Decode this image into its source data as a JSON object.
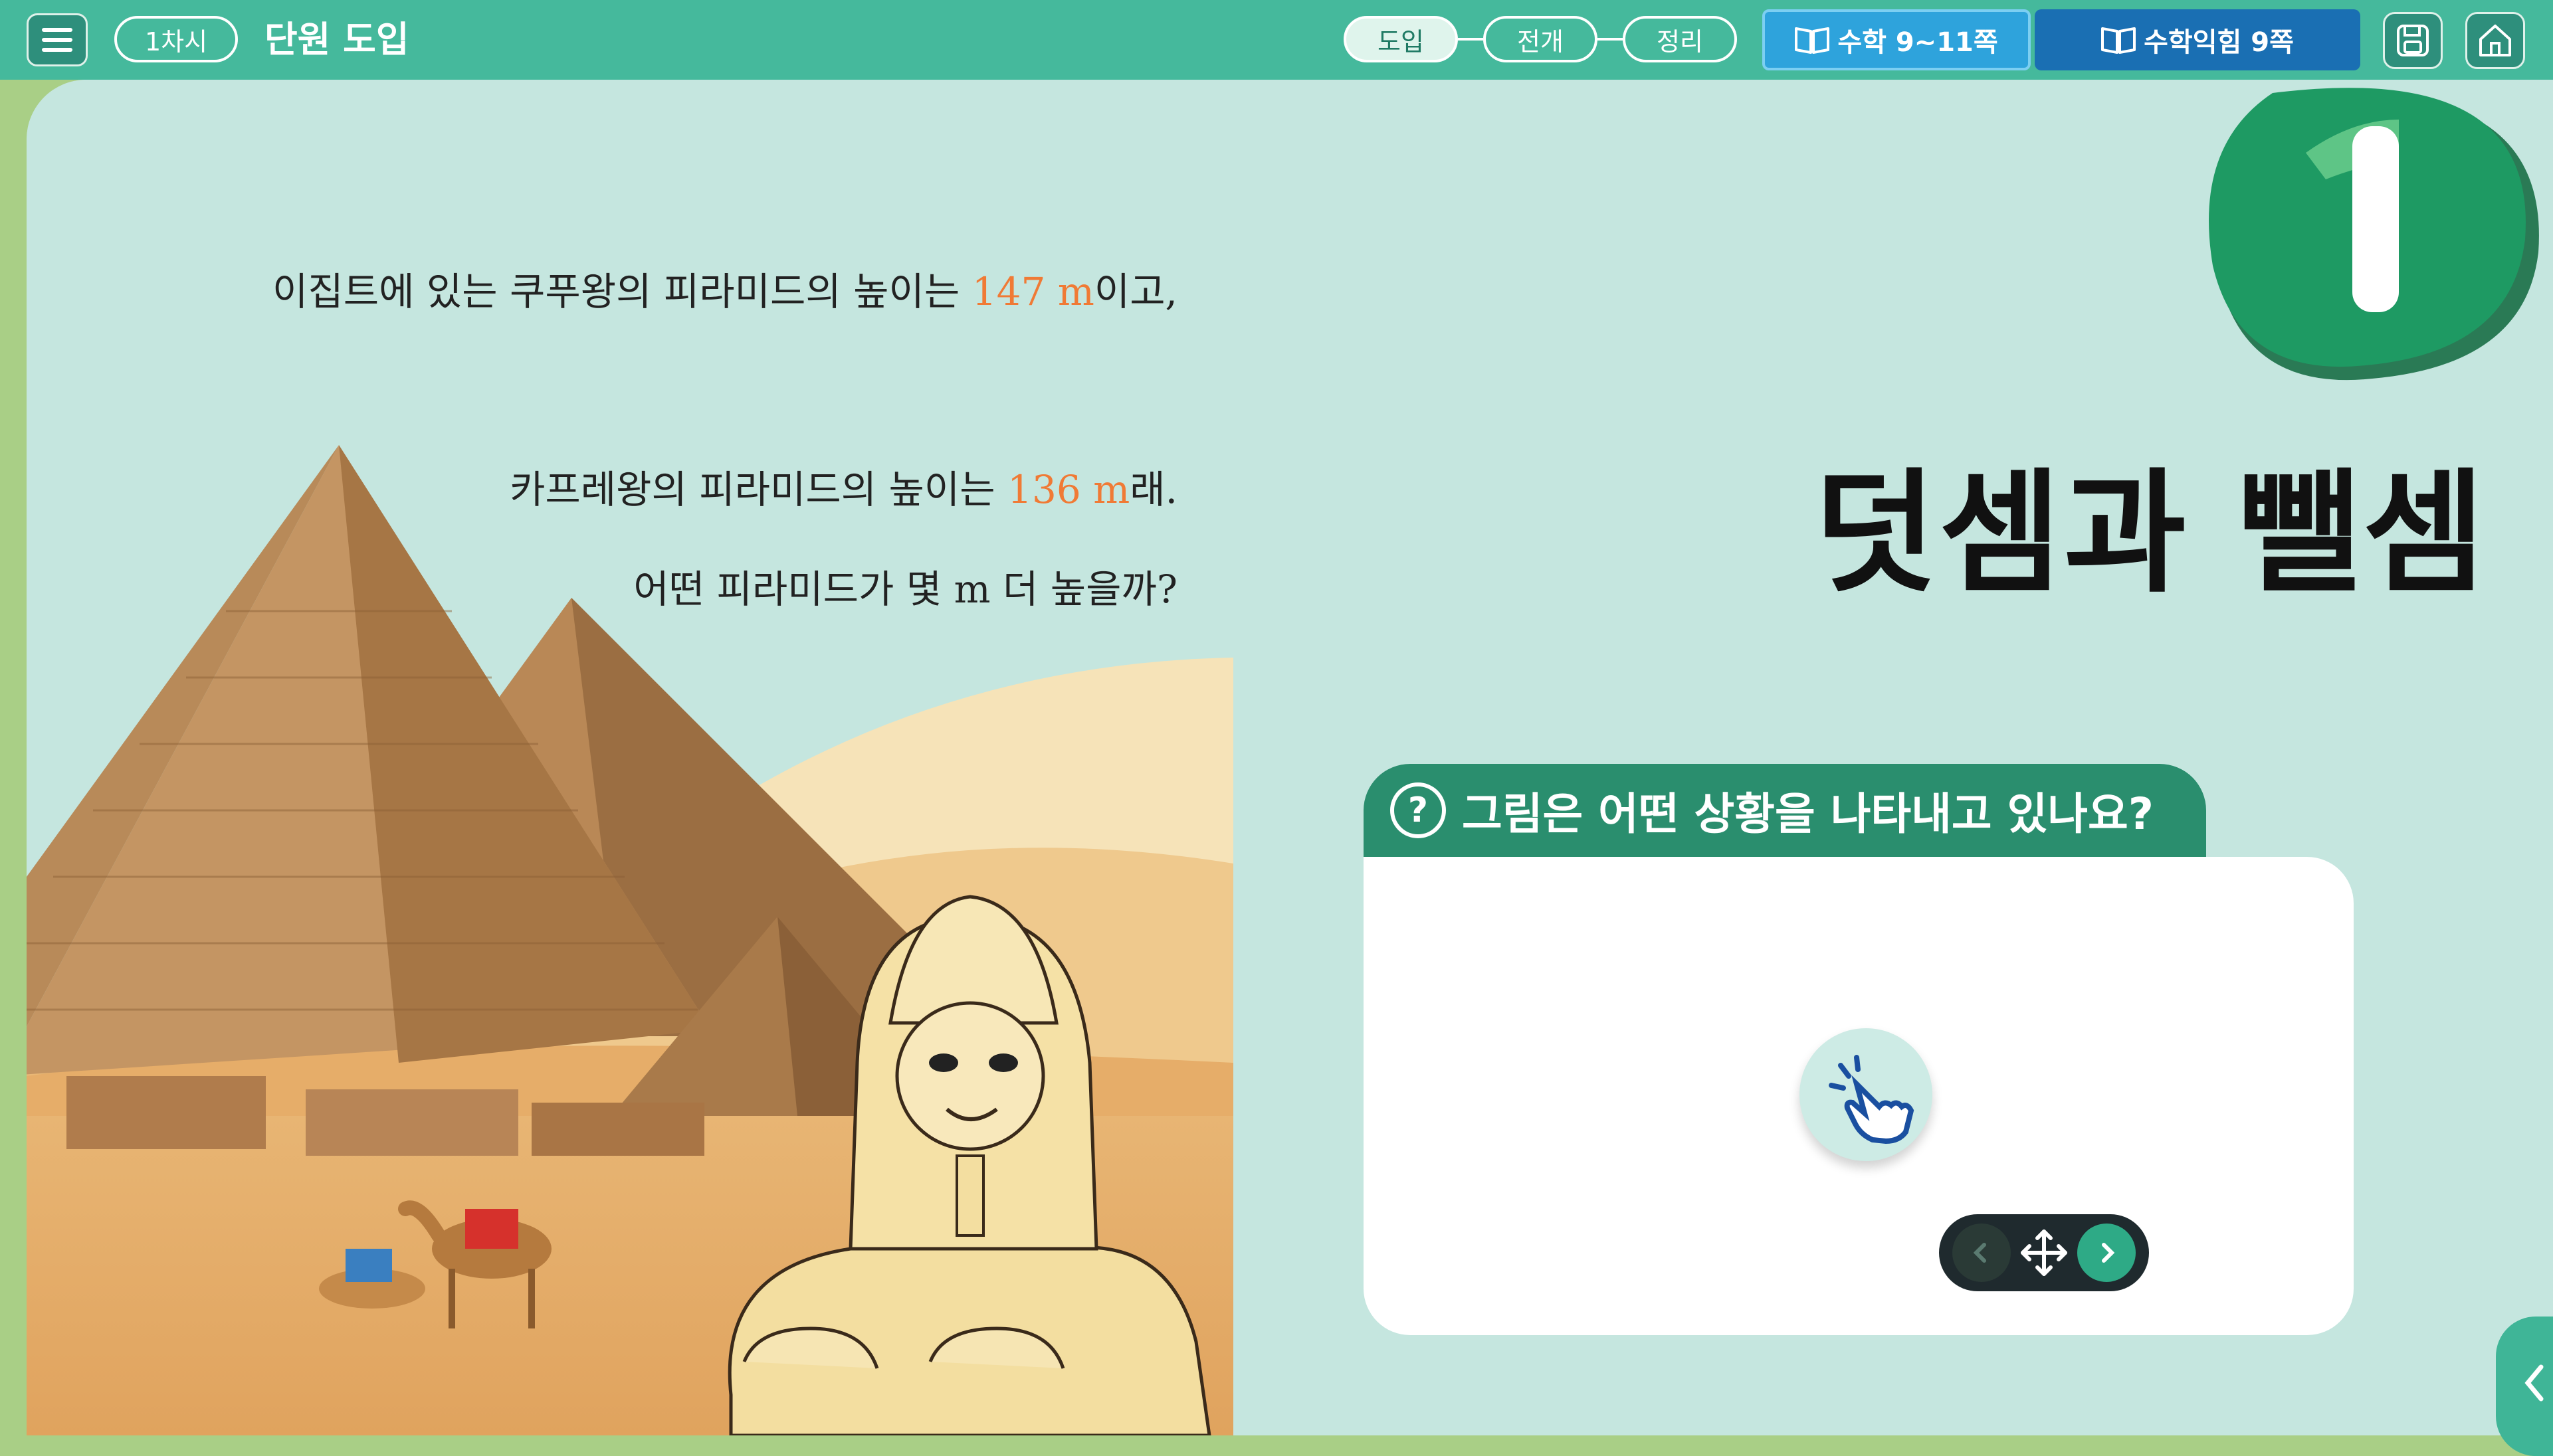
{
  "header": {
    "session": "1차시",
    "unit_title": "단원 도입",
    "steps": [
      "도입",
      "전개",
      "정리"
    ],
    "active_step": "도입",
    "books": [
      "수학 9~11쪽",
      "수학익힘 9쪽"
    ]
  },
  "story": {
    "line1_pre": "이집트에 있는 쿠푸왕의 피라미드의 높이는 ",
    "line1_num": "147 m",
    "line1_post": "이고,",
    "line2_pre": "카프레왕의 피라미드의 높이는 ",
    "line2_num": "136 m",
    "line2_post": "래.",
    "line3": "어떤 피라미드가 몇 m 더 높을까?"
  },
  "chapter": {
    "number": "1",
    "title": "덧셈과 뺄셈"
  },
  "question": {
    "mark": "?",
    "text": "그림은 어떤 상황을 나타내고 있나요?"
  },
  "colors": {
    "topbar": "#45b99c",
    "stage": "#c5e6df",
    "accent_orange": "#f07a35",
    "chapter_green": "#1e9a63",
    "question_tab": "#2a8e6e"
  }
}
